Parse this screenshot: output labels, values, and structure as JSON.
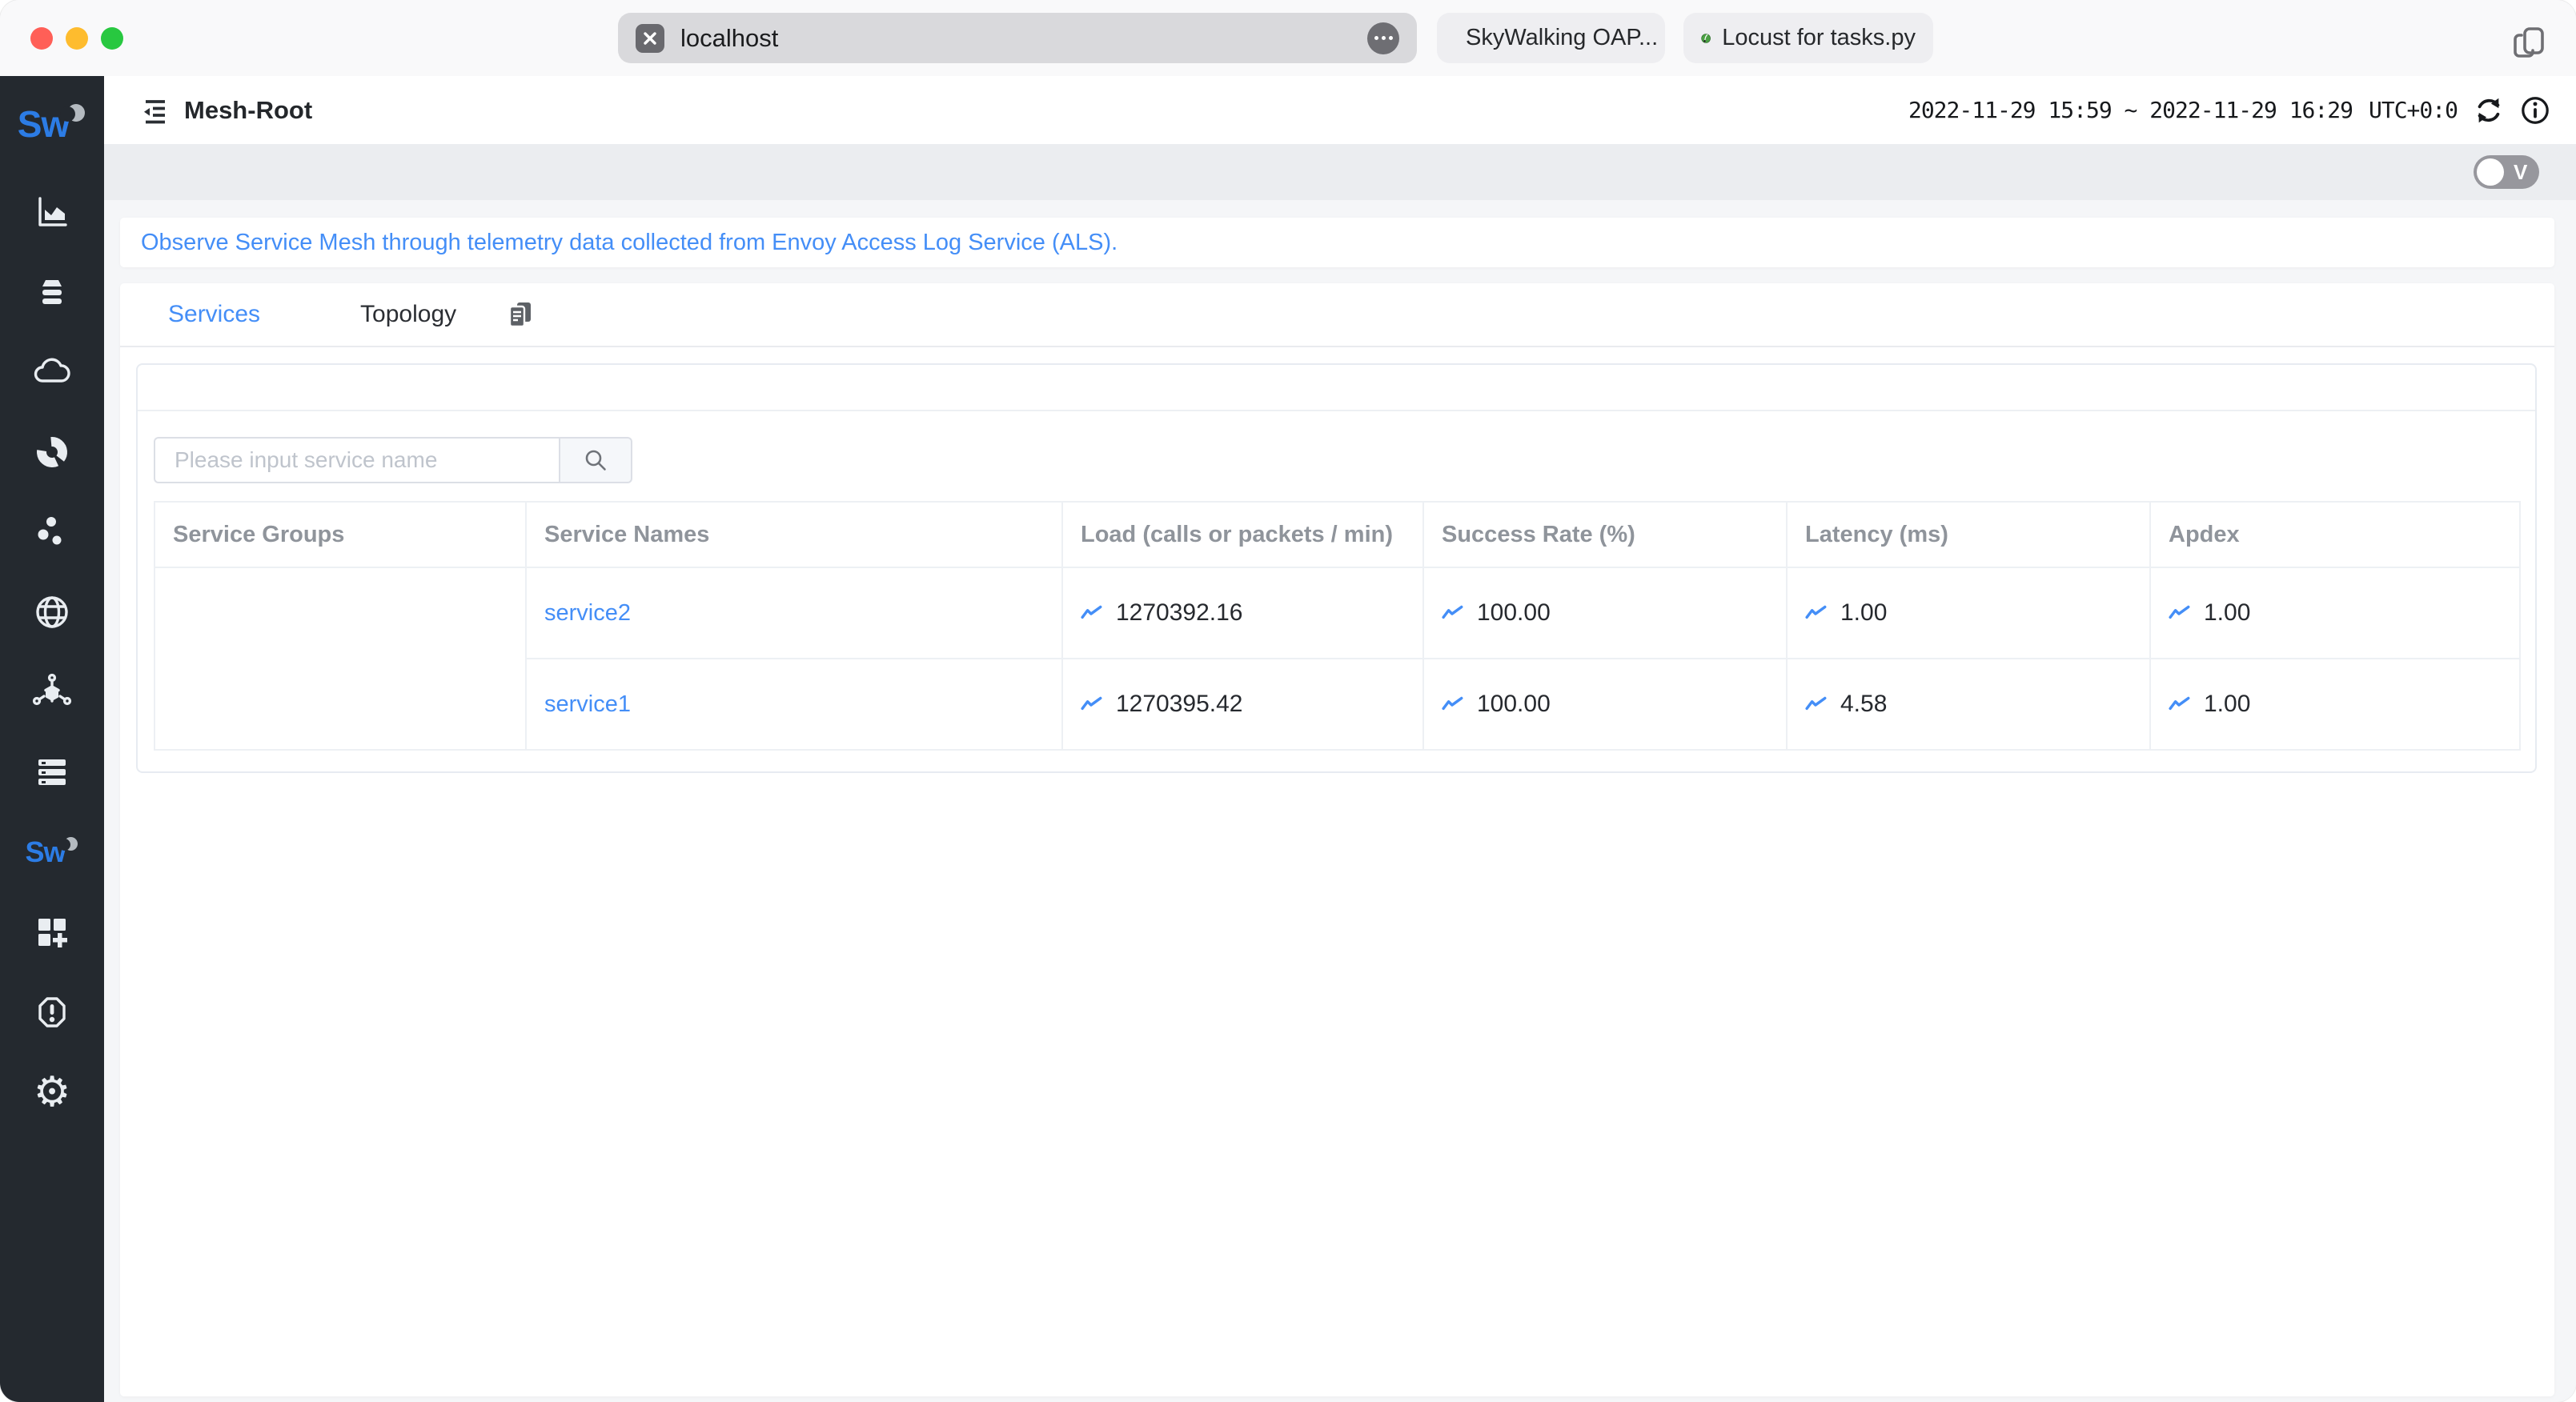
{
  "browser": {
    "url": "localhost",
    "tabs": [
      {
        "label": "SkyWalking OAP..."
      },
      {
        "label": "Locust for tasks.py"
      }
    ]
  },
  "header": {
    "title": "Mesh-Root",
    "time_range": "2022-11-29 15:59 ~ 2022-11-29 16:29",
    "timezone": "UTC+0:0"
  },
  "toolbar": {
    "version_toggle_label": "V"
  },
  "notice": {
    "text": "Observe Service Mesh through telemetry data collected from Envoy Access Log Service (ALS)."
  },
  "tabs": {
    "services": "Services",
    "topology": "Topology"
  },
  "search": {
    "placeholder": "Please input service name"
  },
  "table": {
    "headers": [
      "Service Groups",
      "Service Names",
      "Load (calls or packets / min)",
      "Success Rate (%)",
      "Latency (ms)",
      "Apdex"
    ],
    "rows": [
      {
        "group": "",
        "name": "service2",
        "load": "1270392.16",
        "success_rate": "100.00",
        "latency": "1.00",
        "apdex": "1.00"
      },
      {
        "group": "",
        "name": "service1",
        "load": "1270395.42",
        "success_rate": "100.00",
        "latency": "4.58",
        "apdex": "1.00"
      }
    ]
  },
  "sidebar": {
    "icons": [
      "bar-chart",
      "database-layers",
      "cloud",
      "donut-chart",
      "scatter-dots",
      "globe",
      "mesh-cube",
      "server-list",
      "skywalking",
      "dashboard-add",
      "alert-hexagon",
      "gear"
    ]
  },
  "colors": {
    "accent": "#448ef7",
    "sidebar_bg": "#24292f",
    "toolbar_bg": "#ebedf0"
  }
}
